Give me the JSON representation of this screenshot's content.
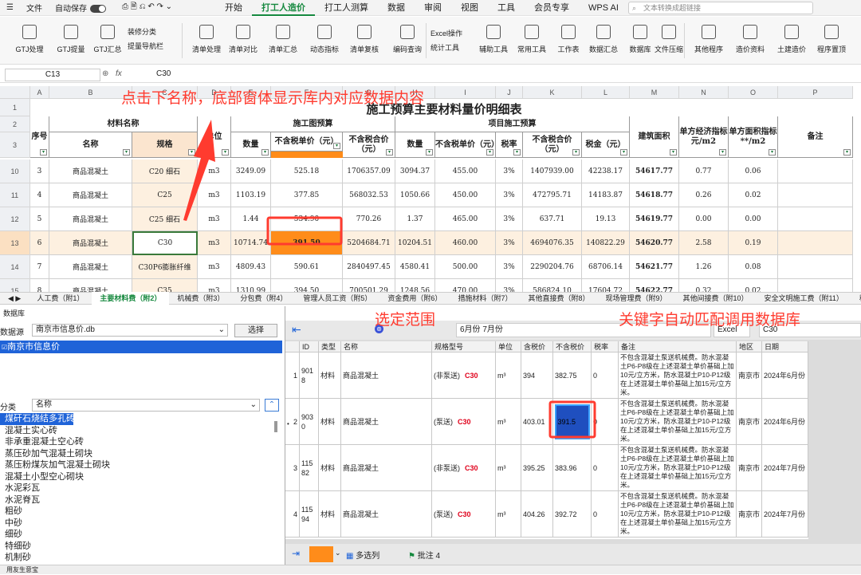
{
  "menubar": {
    "file": "文件",
    "autosave": "自动保存"
  },
  "tabs": [
    "开始",
    "打工人造价",
    "打工人测算",
    "数据",
    "审阅",
    "视图",
    "工具",
    "会员专享",
    "WPS AI"
  ],
  "active_tab": "打工人造价",
  "search": {
    "placeholder": "文本转换成超链接"
  },
  "ribbon": {
    "group1": [
      "GTJ处理",
      "GTJ提量",
      "GTJ汇总"
    ],
    "decor_items": [
      "装修分类",
      "提量导航栏"
    ],
    "group2": [
      "清单处理",
      "清单对比",
      "清单汇总",
      "动态指标",
      "清单复核",
      "编码查询"
    ],
    "excel_ops": [
      "Excel操作",
      "统计工具"
    ],
    "group3": [
      "辅助工具",
      "常用工具",
      "工作表",
      "数据汇总",
      "数据库",
      "文件压缩"
    ],
    "group4": [
      "其他程序",
      "造价资料",
      "土建造价",
      "程序置顶"
    ]
  },
  "formula": {
    "cell_ref": "C13",
    "fx": "fx",
    "value": "C30"
  },
  "sheet": {
    "title": "施工预算主要材料量价明细表",
    "col_letters": [
      "A",
      "B",
      "C",
      "D",
      "E",
      "F",
      "G",
      "H",
      "I",
      "J",
      "K",
      "L",
      "M",
      "N",
      "O",
      "P"
    ],
    "h_seq": "序号",
    "h_material": "材料名称",
    "h_name": "名称",
    "h_spec": "规格",
    "h_unit": "单位",
    "h_budget": "施工图预算",
    "h_project": "项目施工预算",
    "h_qty": "数量",
    "h_price_ex": "不含税单价（元）",
    "h_total_in": "不含税合价（元）",
    "h_qty2": "数量",
    "h_price_ex2": "不含税单价（元）",
    "h_tax": "税率",
    "h_total_in2": "不含税合价（元）",
    "h_taxamt": "税金（元）",
    "h_area": "建筑面积",
    "h_index1": "单方经济指标元/m2",
    "h_index2": "单方面积指标**/m2",
    "h_note": "备注",
    "rows": [
      {
        "rn": "10",
        "seq": "3",
        "name": "商品混凝土",
        "spec": "C20 细石",
        "unit": "m3",
        "qty": "3249.09",
        "price": "525.18",
        "total": "1706357.09",
        "qty2": "3094.37",
        "price2": "455.00",
        "tax": "3%",
        "total2": "1407939.00",
        "taxamt": "42238.17",
        "area": "54617.77",
        "idx1": "0.77",
        "idx2": "0.06"
      },
      {
        "rn": "11",
        "seq": "4",
        "name": "商品混凝土",
        "spec": "C25",
        "unit": "m3",
        "qty": "1103.19",
        "price": "377.85",
        "total": "568032.53",
        "qty2": "1050.66",
        "price2": "450.00",
        "tax": "3%",
        "total2": "472795.71",
        "taxamt": "14183.87",
        "area": "54618.77",
        "idx1": "0.26",
        "idx2": "0.02"
      },
      {
        "rn": "12",
        "seq": "5",
        "name": "商品混凝土",
        "spec": "C25 细石",
        "unit": "m3",
        "qty": "1.44",
        "price": "534.90",
        "total": "770.26",
        "qty2": "1.37",
        "price2": "465.00",
        "tax": "3%",
        "total2": "637.71",
        "taxamt": "19.13",
        "area": "54619.77",
        "idx1": "0.00",
        "idx2": "0.00"
      },
      {
        "rn": "13",
        "seq": "6",
        "name": "商品混凝土",
        "spec": "C30",
        "unit": "m3",
        "qty": "10714.74",
        "price": "391.50",
        "total": "5204684.71",
        "qty2": "10204.51",
        "price2": "460.00",
        "tax": "3%",
        "total2": "4694076.35",
        "taxamt": "140822.29",
        "area": "54620.77",
        "idx1": "2.58",
        "idx2": "0.19"
      },
      {
        "rn": "14",
        "seq": "7",
        "name": "商品混凝土",
        "spec": "C30P6膨胀纤维",
        "unit": "m3",
        "qty": "4809.43",
        "price": "590.61",
        "total": "2840497.45",
        "qty2": "4580.41",
        "price2": "500.00",
        "tax": "3%",
        "total2": "2290204.76",
        "taxamt": "68706.14",
        "area": "54621.77",
        "idx1": "1.26",
        "idx2": "0.08"
      },
      {
        "rn": "15",
        "seq": "8",
        "name": "商品混凝土",
        "spec": "C35",
        "unit": "m3",
        "qty": "1310.99",
        "price": "394.50",
        "total": "700501.29",
        "qty2": "1248.56",
        "price2": "470.00",
        "tax": "3%",
        "total2": "586824.10",
        "taxamt": "17604.72",
        "area": "54622.77",
        "idx1": "0.32",
        "idx2": "0.02"
      }
    ]
  },
  "sheet_tabs": [
    "人工费（附1）",
    "主要材料费（附2）",
    "机械费（附3）",
    "分包费（附4）",
    "管理人员工资（附5）",
    "资金费用（附6）",
    "措施材料（附7）",
    "其他直接费（附8）",
    "现场管理费（附9）",
    "其他间接费（附10）",
    "安全文明施工费（附11）",
    "税务"
  ],
  "active_sheet": "主要材料费（附2）",
  "db": {
    "title": "数据库",
    "source_label": "数据源",
    "source_value": "南京市信息价.db",
    "select_btn": "选择",
    "tree_root": "南京市信息价",
    "class_label": "分类",
    "class_value": "名称",
    "categories": [
      "煤矸石烧结多孔砖",
      "混凝土实心砖",
      "非承重混凝土空心砖",
      "蒸压砂加气混凝土砌块",
      "蒸压粉煤灰加气混凝土砌块",
      "混凝土小型空心砌块",
      "水泥彩瓦",
      "水泥脊瓦",
      "粗砂",
      "中砂",
      "细砂",
      "特细砂",
      "机制砂"
    ],
    "selected_category": "煤矸石烧结多孔砖"
  },
  "result": {
    "range_value": "6月份 7月份",
    "excel_label": "Excel",
    "keyword": "C30",
    "headers": [
      "ID",
      "类型",
      "名称",
      "规格型号",
      "单位",
      "含税价",
      "不含税价",
      "税率",
      "备注",
      "地区",
      "日期"
    ],
    "rows": [
      {
        "num": "1",
        "id": "9018",
        "type": "材料",
        "name": "商品混凝土",
        "spec_pre": "(非泵送)",
        "spec_kw": "C30",
        "unit": "m³",
        "price_in": "394",
        "price_ex": "382.75",
        "tax": "0",
        "note": "不包含混凝土泵送机械费。防水混凝土P6-P8级在上述混凝土单价基础上加10元/立方米，防水混凝土P10-P12级在上述混凝土单价基础上加15元/立方米。",
        "region": "南京市",
        "date": "2024年6月份"
      },
      {
        "num": "2",
        "id": "9030",
        "type": "材料",
        "name": "商品混凝土",
        "spec_pre": "(泵送)",
        "spec_kw": "C30",
        "unit": "m³",
        "price_in": "403.01",
        "price_ex": "391.5",
        "tax": "0",
        "note": "不包含混凝土泵送机械费。防水混凝土P6-P8级在上述混凝土单价基础上加10元/立方米，防水混凝土P10-P12级在上述混凝土单价基础上加15元/立方米。",
        "region": "南京市",
        "date": "2024年6月份"
      },
      {
        "num": "3",
        "id": "11582",
        "type": "材料",
        "name": "商品混凝土",
        "spec_pre": "(非泵送)",
        "spec_kw": "C30",
        "unit": "m³",
        "price_in": "395.25",
        "price_ex": "383.96",
        "tax": "0",
        "note": "不包含混凝土泵送机械费。防水混凝土P6-P8级在上述混凝土单价基础上加10元/立方米，防水混凝土P10-P12级在上述混凝土单价基础上加15元/立方米。",
        "region": "南京市",
        "date": "2024年7月份"
      },
      {
        "num": "4",
        "id": "11594",
        "type": "材料",
        "name": "商品混凝土",
        "spec_pre": "(泵送)",
        "spec_kw": "C30",
        "unit": "m³",
        "price_in": "404.26",
        "price_ex": "392.72",
        "tax": "0",
        "note": "不包含混凝土泵送机械费。防水混凝土P6-P8级在上述混凝土单价基础上加10元/立方米，防水混凝土P10-P12级在上述混凝土单价基础上加15元/立方米。",
        "region": "南京市",
        "date": "2024年7月份"
      }
    ],
    "bottom_multi": "多选列",
    "bottom_note": "批注 4"
  },
  "annotations": {
    "top": "点击下名称，底部窗体显示库内对应数据内容",
    "range": "选定范围",
    "keyword": "关键字自动匹配调用数据库"
  },
  "status": {
    "text": "用友生意宝"
  },
  "colors": {
    "accent": "#16893f",
    "annot": "#ff3b2f",
    "highlight_orange": "#ff8c1a",
    "selection_blue": "#1f63d8"
  }
}
